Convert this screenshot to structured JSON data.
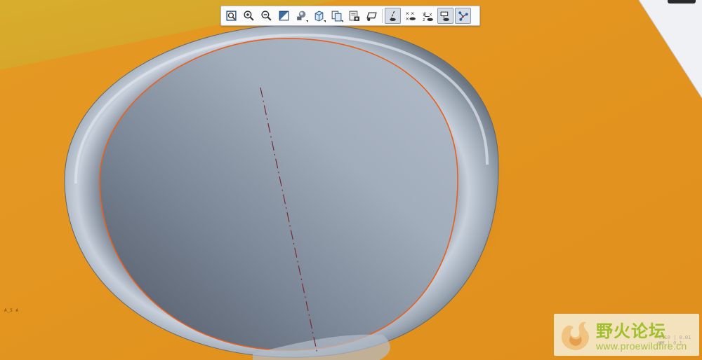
{
  "viewport": {
    "background_color": "#e2941f",
    "surface_top_color": "#d4a92a",
    "right_panel_color": "#f0f1f5",
    "part_color": "#9aa5b2",
    "edge_highlight_color": "#e8601c",
    "axis_line_color": "#7a2a35"
  },
  "toolbar": {
    "items": [
      {
        "name": "refit-icon",
        "tooltip": "Refit",
        "active": false
      },
      {
        "name": "zoom-in-icon",
        "tooltip": "Zoom In",
        "active": false
      },
      {
        "name": "zoom-out-icon",
        "tooltip": "Zoom Out",
        "active": false
      },
      {
        "name": "repaint-icon",
        "tooltip": "Repaint",
        "active": false
      },
      {
        "name": "display-style-icon",
        "tooltip": "Display Style",
        "active": false
      },
      {
        "name": "saved-orientations-icon",
        "tooltip": "Saved Orientations",
        "active": false
      },
      {
        "name": "view-manager-icon",
        "tooltip": "View Manager",
        "active": false
      },
      {
        "name": "perspective-view-icon",
        "tooltip": "Perspective View",
        "active": false
      },
      {
        "name": "plane-display-icon",
        "tooltip": "Plane Display",
        "active": false
      },
      {
        "name": "axis-display-icon",
        "tooltip": "Axis Display",
        "active": true
      },
      {
        "name": "point-display-icon",
        "tooltip": "Point Display",
        "active": false
      },
      {
        "name": "csys-display-icon",
        "tooltip": "Csys Display",
        "active": false
      },
      {
        "name": "annotation-display-icon",
        "tooltip": "Annotation Display",
        "active": true
      },
      {
        "name": "spin-center-icon",
        "tooltip": "Spin Center",
        "active": true
      }
    ]
  },
  "status": {
    "tiny_text": "A_5 A"
  },
  "watermark": {
    "site_name_cn": "野火论坛",
    "url": "www.proewildfire.cn",
    "ghost_text": "T:10 | 0.01\nMM | 0.1"
  }
}
